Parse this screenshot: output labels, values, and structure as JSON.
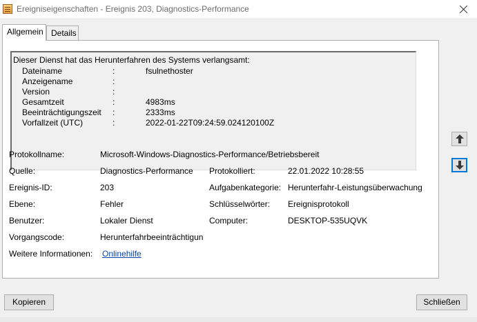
{
  "window": {
    "title": "Ereigniseigenschaften - Ereignis 203, Diagnostics-Performance"
  },
  "tabs": [
    {
      "label": "Allgemein",
      "active": true
    },
    {
      "label": "Details",
      "active": false
    }
  ],
  "description": {
    "headline": "Dieser Dienst hat das Herunterfahren des Systems verlangsamt:",
    "rows": [
      {
        "label": "Dateiname",
        "colon": ":",
        "value": "fsulnethoster"
      },
      {
        "label": "Anzeigename",
        "colon": ":",
        "value": ""
      },
      {
        "label": "Version",
        "colon": ":",
        "value": ""
      },
      {
        "label": "Gesamtzeit",
        "colon": ":",
        "value": "4983ms"
      },
      {
        "label": "Beeinträchtigungszeit",
        "colon": ":",
        "value": "2333ms"
      },
      {
        "label": "Vorfallzeit (UTC)",
        "colon": ":",
        "value": "2022-01-22T09:24:59.024120100Z"
      }
    ]
  },
  "fields": {
    "log_name": {
      "label": "Protokollname:",
      "value": "Microsoft-Windows-Diagnostics-Performance/Betriebsbereit"
    },
    "source": {
      "label": "Quelle:",
      "value": "Diagnostics-Performance"
    },
    "logged": {
      "label": "Protokolliert:",
      "value": "22.01.2022 10:28:55"
    },
    "event_id": {
      "label": "Ereignis-ID:",
      "value": "203"
    },
    "task_category": {
      "label": "Aufgabenkategorie:",
      "value": "Herunterfahr-Leistungsüberwachung"
    },
    "level": {
      "label": "Ebene:",
      "value": "Fehler"
    },
    "keywords": {
      "label": "Schlüsselwörter:",
      "value": "Ereignisprotokoll"
    },
    "user": {
      "label": "Benutzer:",
      "value": "Lokaler Dienst"
    },
    "computer": {
      "label": "Computer:",
      "value": "DESKTOP-535UQVK"
    },
    "opcode": {
      "label": "Vorgangscode:",
      "value": "Herunterfahrbeeinträchtigung"
    },
    "more_info": {
      "label": "Weitere Informationen:",
      "link": "Onlinehilfe"
    }
  },
  "nav": {
    "up_icon": "arrow-up-icon",
    "down_icon": "arrow-down-icon"
  },
  "buttons": {
    "copy": "Kopieren",
    "close": "Schließen"
  },
  "colors": {
    "link": "#0645ad",
    "focus": "#0078d7",
    "window_bg": "#f0f0f0"
  }
}
